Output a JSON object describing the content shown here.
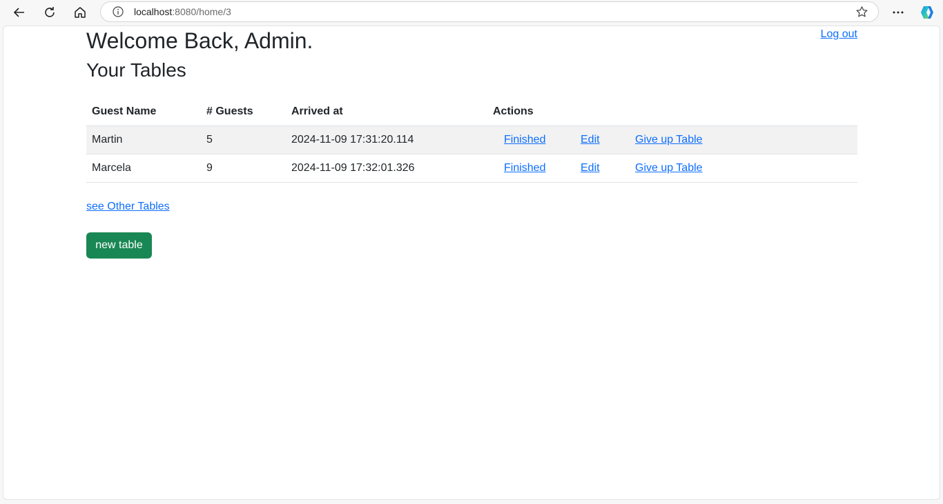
{
  "browser": {
    "url_host": "localhost",
    "url_path": ":8080/home/3"
  },
  "header": {
    "welcome": "Welcome Back, Admin.",
    "logout_label": "Log out",
    "subtitle": "Your Tables"
  },
  "table": {
    "headers": [
      "Guest Name",
      "# Guests",
      "Arrived at",
      "Actions"
    ],
    "rows": [
      {
        "name": "Martin",
        "guests": "5",
        "arrived": "2024-11-09 17:31:20.114",
        "finished": "Finished",
        "edit": "Edit",
        "give_up": "Give up Table"
      },
      {
        "name": "Marcela",
        "guests": "9",
        "arrived": "2024-11-09 17:32:01.326",
        "finished": "Finished",
        "edit": "Edit",
        "give_up": "Give up Table"
      }
    ]
  },
  "links": {
    "other_tables": "see Other Tables"
  },
  "buttons": {
    "new_table": "new table"
  },
  "colors": {
    "link": "#0d6efd",
    "button": "#198754",
    "stripe": "#f2f2f2"
  }
}
